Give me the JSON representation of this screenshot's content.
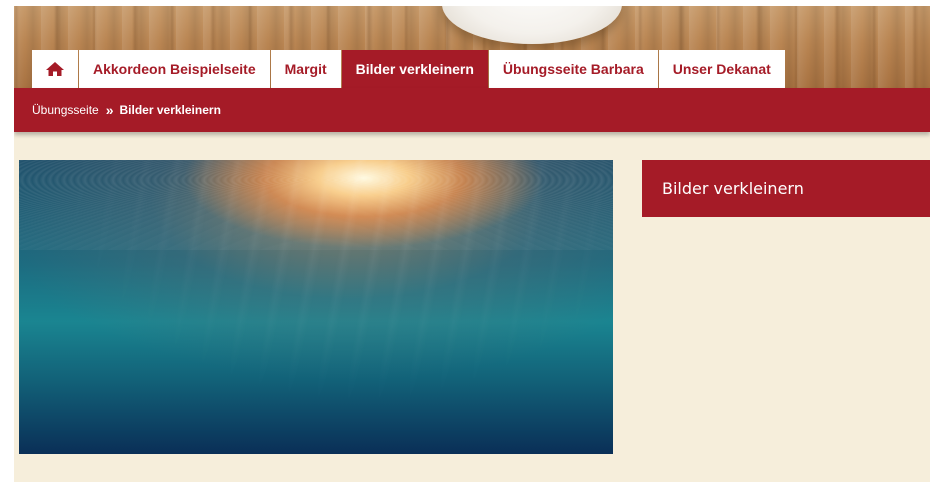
{
  "nav": {
    "home_icon": "home-icon",
    "tabs": [
      {
        "label": "Akkordeon Beispielseite",
        "active": false
      },
      {
        "label": "Margit",
        "active": false
      },
      {
        "label": "Bilder verkleinern",
        "active": true
      },
      {
        "label": "Übungsseite Barbara",
        "active": false
      },
      {
        "label": "Unser Dekanat",
        "active": false
      }
    ]
  },
  "breadcrumb": {
    "parent": "Übungsseite",
    "separator": "»",
    "current": "Bilder verkleinern"
  },
  "sidebar": {
    "title": "Bilder verkleinern"
  },
  "colors": {
    "brand_red": "#a51b27",
    "page_background": "#f6eedb",
    "tab_background": "#ffffff"
  }
}
